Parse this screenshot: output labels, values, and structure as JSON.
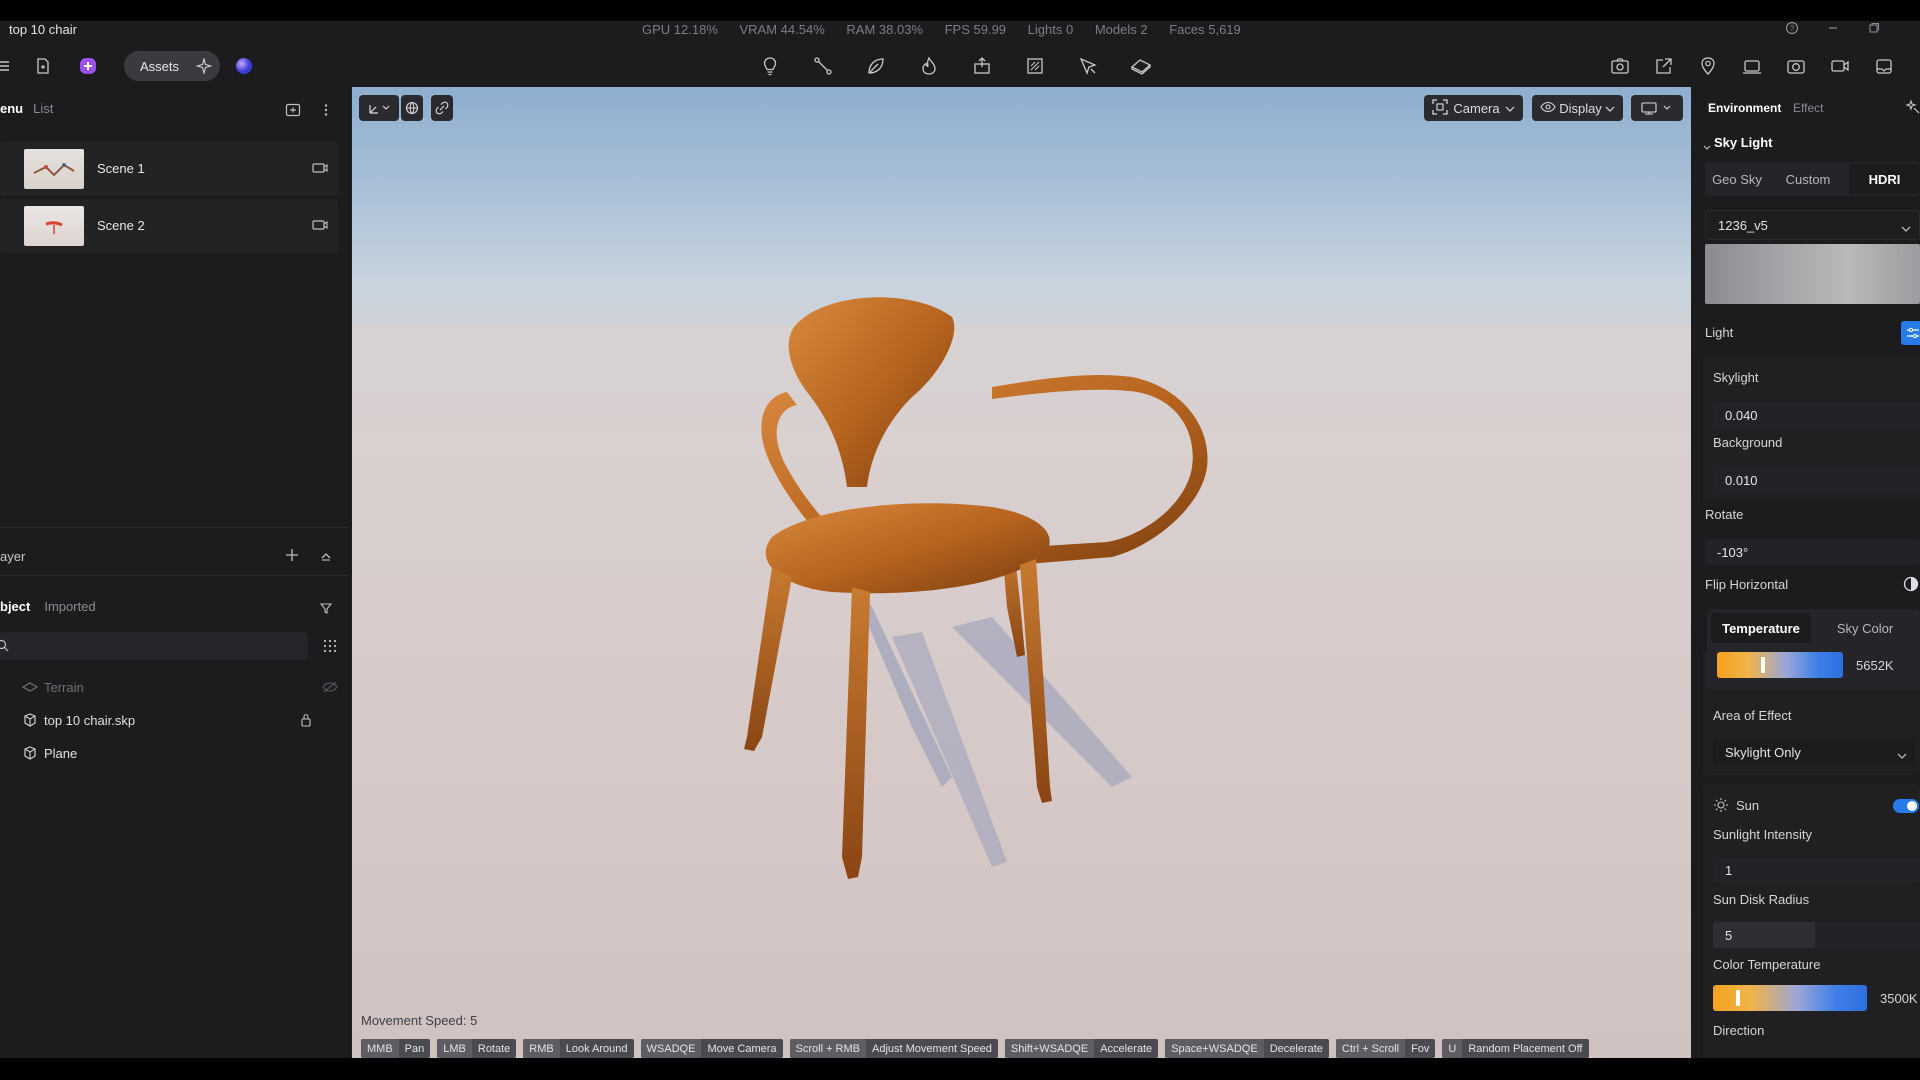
{
  "window": {
    "title": "top 10 chair"
  },
  "stats": [
    "GPU 12.18%",
    "VRAM 44.54%",
    "RAM 38.03%",
    "FPS 59.99",
    "Lights 0",
    "Models 2",
    "Faces 5,619"
  ],
  "toolbar": {
    "assets_label": "Assets"
  },
  "left": {
    "tab_menu": "enu",
    "tab_list": "List",
    "scenes": [
      "Scene 1",
      "Scene 2"
    ],
    "layer_title": "ayer",
    "tab_object": "bject",
    "tab_imported": "Imported",
    "tree": [
      "Terrain",
      "top 10 chair.skp",
      "Plane"
    ]
  },
  "viewport": {
    "camera_label": "Camera",
    "display_label": "Display",
    "movement_speed": "Movement Speed: 5",
    "hints": [
      {
        "key": "MMB",
        "desc": "Pan"
      },
      {
        "key": "LMB",
        "desc": "Rotate"
      },
      {
        "key": "RMB",
        "desc": "Look Around"
      },
      {
        "key": "WSADQE",
        "desc": "Move Camera"
      },
      {
        "key": "Scroll + RMB",
        "desc": "Adjust Movement Speed"
      },
      {
        "key": "Shift+WSADQE",
        "desc": "Accelerate"
      },
      {
        "key": "Space+WSADQE",
        "desc": "Decelerate"
      },
      {
        "key": "Ctrl + Scroll",
        "desc": "Fov"
      },
      {
        "key": "U",
        "desc": "Random Placement Off"
      }
    ]
  },
  "right": {
    "tab_environment": "Environment",
    "tab_effect": "Effect",
    "sky_light": "Sky Light",
    "seg_geo": "Geo Sky",
    "seg_custom": "Custom",
    "seg_hdri": "HDRI",
    "hdri_name": "1236_v5",
    "light_label": "Light",
    "skylight_label": "Skylight",
    "skylight_value": "0.040",
    "background_label": "Background",
    "background_value": "0.010",
    "rotate_label": "Rotate",
    "rotate_value": "-103°",
    "flip_label": "Flip Horizontal",
    "tab_temperature": "Temperature",
    "tab_skycolor": "Sky Color",
    "temperature_value": "5652K",
    "temperature_fraction": 0.36,
    "area_label": "Area of Effect",
    "area_value": "Skylight Only",
    "sun_label": "Sun",
    "sunlight_label": "Sunlight Intensity",
    "sunlight_value": "1",
    "sundisk_label": "Sun Disk Radius",
    "sundisk_value": "5",
    "colortemp_label": "Color Temperature",
    "colortemp_value": "3500K",
    "colortemp_fraction": 0.15,
    "direction_label": "Direction",
    "accent": "#2a7bea"
  }
}
